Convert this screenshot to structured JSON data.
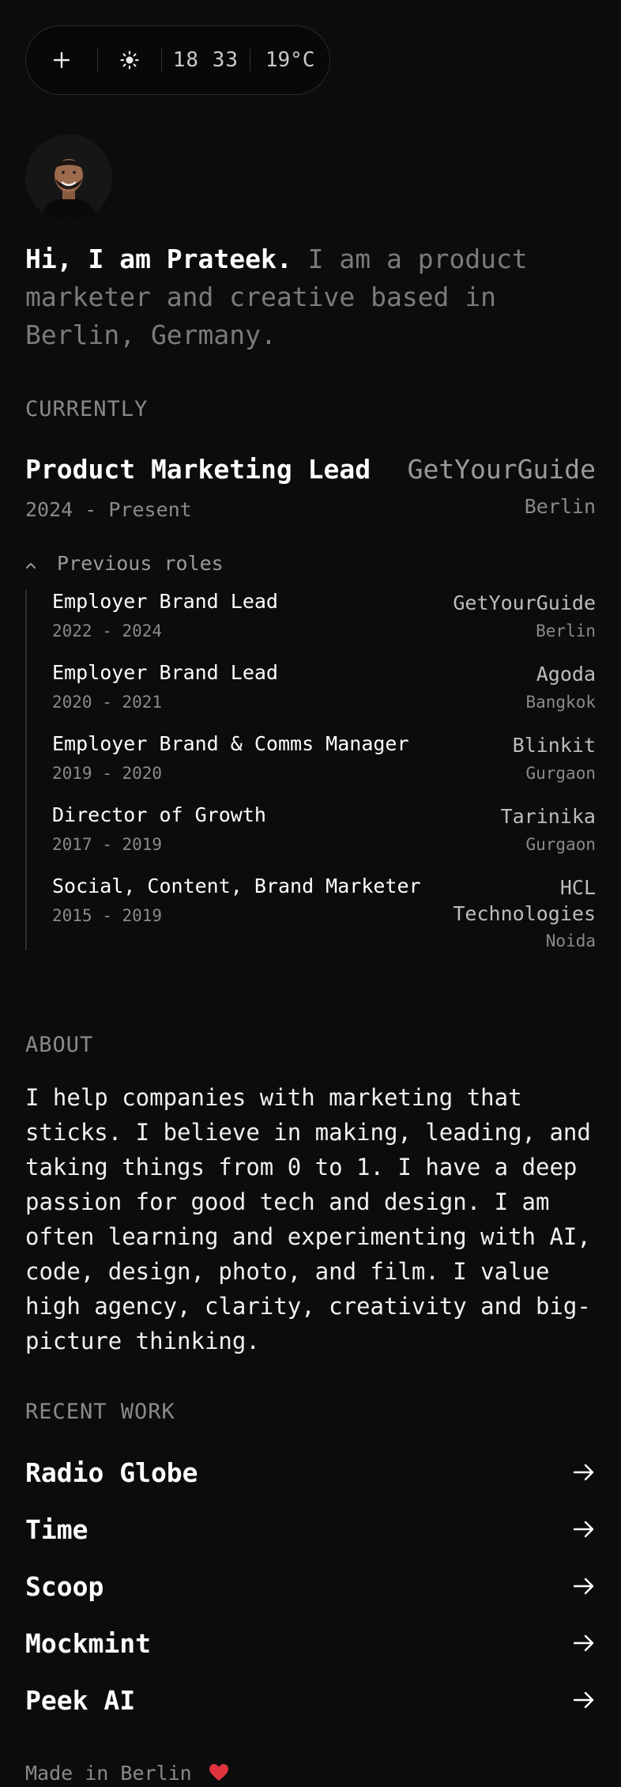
{
  "status_bar": {
    "add_icon": "plus-icon",
    "theme_icon": "sun-icon",
    "time": "18 33",
    "temperature": "19°C"
  },
  "intro": {
    "greeting": "Hi, I am Prateek.",
    "description": "I am a product marketer and creative based in Berlin, Germany."
  },
  "currently": {
    "label": "CURRENTLY",
    "title": "Product Marketing Lead",
    "company": "GetYourGuide",
    "years": "2024 - Present",
    "city": "Berlin"
  },
  "previous": {
    "toggle_label": "Previous roles",
    "roles": [
      {
        "title": "Employer Brand Lead",
        "years": "2022 - 2024",
        "company": "GetYourGuide",
        "city": "Berlin"
      },
      {
        "title": "Employer Brand Lead",
        "years": "2020 - 2021",
        "company": "Agoda",
        "city": "Bangkok"
      },
      {
        "title": "Employer Brand & Comms Manager",
        "years": "2019 - 2020",
        "company": "Blinkit",
        "city": "Gurgaon"
      },
      {
        "title": "Director of Growth",
        "years": "2017 - 2019",
        "company": "Tarinika",
        "city": "Gurgaon"
      },
      {
        "title": "Social, Content, Brand Marketer",
        "years": "2015 - 2019",
        "company_line1": "HCL",
        "company_line2": "Technologies",
        "city": "Noida"
      }
    ]
  },
  "about": {
    "label": "ABOUT",
    "text": "I help companies with marketing that sticks. I believe in making, leading, and taking things from 0 to 1. I have a deep passion for good tech and design. I am often learning and experimenting with AI, code, design, photo, and film. I value high agency, clarity, creativity and big-picture thinking."
  },
  "recent_work": {
    "label": "RECENT WORK",
    "items": [
      {
        "name": "Radio Globe"
      },
      {
        "name": "Time"
      },
      {
        "name": "Scoop"
      },
      {
        "name": "Mockmint"
      },
      {
        "name": "Peek AI"
      }
    ]
  },
  "footer": {
    "text": "Made in Berlin",
    "heart_icon": "heart-icon",
    "heart_color": "#e0343f"
  },
  "colors": {
    "background": "#0c0c0c",
    "muted_text": "#8a8a8a"
  }
}
